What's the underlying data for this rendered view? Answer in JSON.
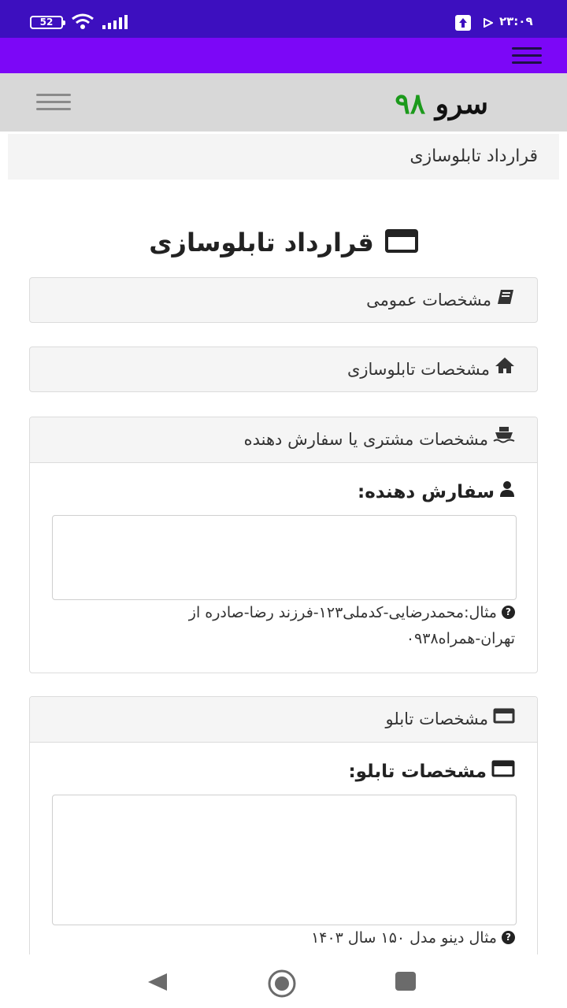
{
  "status_bar": {
    "battery": "52",
    "time": "۲۳:۰۹",
    "icons": [
      "battery-icon",
      "wifi-icon",
      "signal-icon",
      "upload-icon",
      "play-icon"
    ],
    "bg_color": "#3d0fbf"
  },
  "top_menu": {
    "icon": "hamburger-icon",
    "bg_color": "#7c07f7"
  },
  "header": {
    "logo_word": "سرو",
    "logo_number": "۹۸",
    "logo_number_color": "#1c9a1c",
    "menu_icon": "hamburger-icon"
  },
  "breadcrumb": {
    "label": "قرارداد تابلوسازی"
  },
  "page": {
    "title": "قرارداد تابلوسازی",
    "title_icon": "window-icon"
  },
  "sections": {
    "general": {
      "label": "مشخصات عمومی",
      "icon": "book-icon"
    },
    "fabrication": {
      "label": "مشخصات تابلوسازی",
      "icon": "home-icon"
    },
    "customer": {
      "label": "مشخصات مشتری یا سفارش دهنده",
      "icon": "ship-icon",
      "field_label": "سفارش دهنده:",
      "field_icon": "user-icon",
      "value": "",
      "help_line1": "مثال:محمدرضایی-کدملی۱۲۳-فرزند رضا-صادره از",
      "help_line2": "تهران-همراه۰۹۳۸"
    },
    "board": {
      "label": "مشخصات تابلو",
      "icon": "window-icon",
      "field_label": "مشخصات تابلو:",
      "field_icon": "window-icon",
      "value": "",
      "help": "مثال دینو مدل ۱۵۰ سال ۱۴۰۳"
    }
  },
  "nav": {
    "icons": [
      "back-icon",
      "home-circle-icon",
      "recents-icon"
    ]
  }
}
